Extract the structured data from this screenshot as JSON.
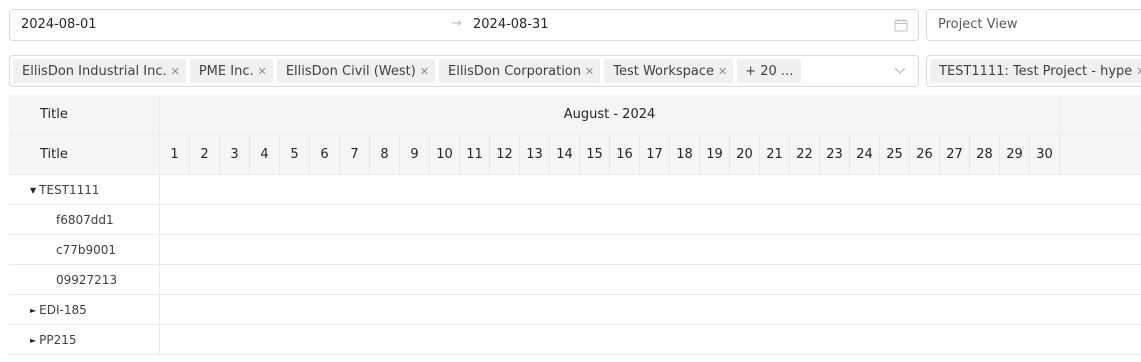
{
  "date_range": {
    "start": "2024-08-01",
    "separator": "→",
    "end": "2024-08-31",
    "icon": "calendar-icon"
  },
  "view_select": {
    "value": "Project View"
  },
  "company_select": {
    "tags": [
      "EllisDon Industrial Inc.",
      "PME Inc.",
      "EllisDon Civil (West)",
      "EllisDon Corporation",
      "Test Workspace"
    ],
    "more_label": "+ 20 ...",
    "icon": "chevron-down-icon"
  },
  "project_select": {
    "tag": "TEST1111: Test Project - hype"
  },
  "gantt": {
    "title_header": "Title",
    "month_label": "August - 2024",
    "days": [
      "1",
      "2",
      "3",
      "4",
      "5",
      "6",
      "7",
      "8",
      "9",
      "10",
      "11",
      "12",
      "13",
      "14",
      "15",
      "16",
      "17",
      "18",
      "19",
      "20",
      "21",
      "22",
      "23",
      "24",
      "25",
      "26",
      "27",
      "28",
      "29",
      "30"
    ],
    "rows": [
      {
        "label": "TEST1111",
        "kind": "group",
        "expanded": true
      },
      {
        "label": "f6807dd1",
        "kind": "child"
      },
      {
        "label": "c77b9001",
        "kind": "child"
      },
      {
        "label": "09927213",
        "kind": "child"
      },
      {
        "label": "EDI-185",
        "kind": "group",
        "expanded": false
      },
      {
        "label": "PP215",
        "kind": "group",
        "expanded": false
      }
    ],
    "carets": {
      "expanded": "▼",
      "collapsed": "►"
    },
    "remove_glyph": "✕"
  }
}
